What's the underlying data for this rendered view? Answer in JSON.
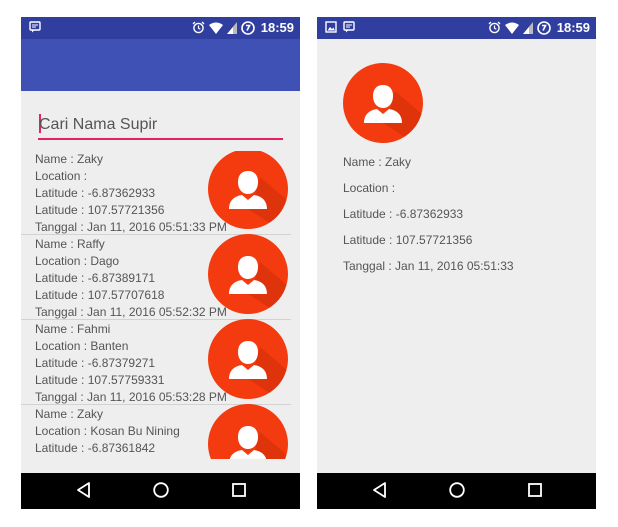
{
  "status": {
    "time": "18:59"
  },
  "colors": {
    "accent": "#e0245e",
    "primary_dark": "#303f9f",
    "primary": "#3f51b5",
    "avatar": "#f43b0f"
  },
  "list_screen": {
    "search": {
      "placeholder": "Cari Nama Supir"
    },
    "items": [
      {
        "name": "Name : Zaky",
        "location": "Location :",
        "lat": "Latitude : -6.87362933",
        "lng": "Latitude : 107.57721356",
        "date": "Tanggal : Jan 11, 2016 05:51:33 PM"
      },
      {
        "name": "Name : Raffy",
        "location": "Location : Dago",
        "lat": "Latitude : -6.87389171",
        "lng": "Latitude : 107.57707618",
        "date": "Tanggal : Jan 11, 2016 05:52:32 PM"
      },
      {
        "name": "Name : Fahmi",
        "location": "Location : Banten",
        "lat": "Latitude : -6.87379271",
        "lng": "Latitude : 107.57759331",
        "date": "Tanggal : Jan 11, 2016 05:53:28 PM"
      },
      {
        "name": "Name : Zaky",
        "location": "Location : Kosan Bu Nining",
        "lat": "Latitude : -6.87361842"
      }
    ]
  },
  "detail_screen": {
    "name": "Name : Zaky",
    "location": "Location :",
    "lat": "Latitude : -6.87362933",
    "lng": "Latitude : 107.57721356",
    "date": "Tanggal : Jan 11, 2016 05:51:33"
  }
}
